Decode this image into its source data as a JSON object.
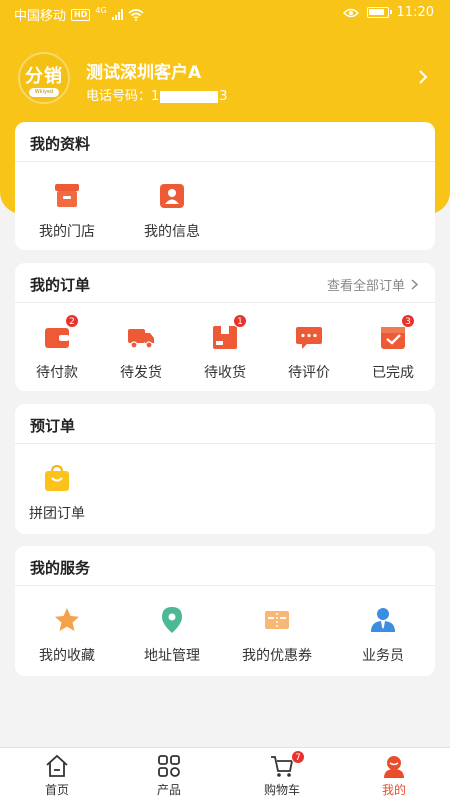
{
  "status_bar": {
    "carrier": "中国移动",
    "network_badge": "HD",
    "network_type": "4G",
    "time": "11:20"
  },
  "profile": {
    "avatar_text": "分销",
    "avatar_sub": "Wkiyed",
    "name": "测试深圳客户A",
    "phone_prefix": "电话号码：1",
    "phone_suffix": "3"
  },
  "my_info": {
    "title": "我的资料",
    "items": [
      {
        "label": "我的门店",
        "icon": "store-icon"
      },
      {
        "label": "我的信息",
        "icon": "person-card-icon"
      }
    ]
  },
  "my_orders": {
    "title": "我的订单",
    "view_all": "查看全部订单",
    "items": [
      {
        "label": "待付款",
        "icon": "wallet-icon",
        "badge": "2"
      },
      {
        "label": "待发货",
        "icon": "truck-icon",
        "badge": ""
      },
      {
        "label": "待收货",
        "icon": "package-icon",
        "badge": "1"
      },
      {
        "label": "待评价",
        "icon": "comment-icon",
        "badge": ""
      },
      {
        "label": "已完成",
        "icon": "box-check-icon",
        "badge": "3"
      }
    ]
  },
  "pre_order": {
    "title": "预订单",
    "items": [
      {
        "label": "拼团订单",
        "icon": "shopping-bag-icon"
      }
    ]
  },
  "my_services": {
    "title": "我的服务",
    "items": [
      {
        "label": "我的收藏",
        "icon": "star-icon"
      },
      {
        "label": "地址管理",
        "icon": "location-pin-icon"
      },
      {
        "label": "我的优惠券",
        "icon": "coupon-icon"
      },
      {
        "label": "业务员",
        "icon": "salesperson-icon"
      }
    ]
  },
  "tabbar": {
    "items": [
      {
        "label": "首页",
        "icon": "home-icon",
        "active": false
      },
      {
        "label": "产品",
        "icon": "grid-icon",
        "active": false
      },
      {
        "label": "购物车",
        "icon": "cart-icon",
        "active": false,
        "badge": "7"
      },
      {
        "label": "我的",
        "icon": "user-icon",
        "active": true
      }
    ]
  },
  "colors": {
    "brand_yellow": "#f9c418",
    "accent_red": "#e84e2c",
    "badge_red": "#e8322b"
  }
}
